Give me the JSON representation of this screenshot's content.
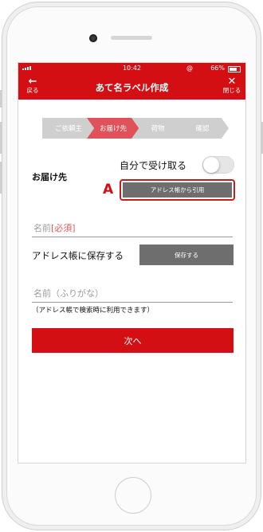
{
  "status_bar": {
    "time": "10:42",
    "battery": "66%"
  },
  "nav": {
    "back_label": "戻る",
    "title": "あて名ラベル作成",
    "close_label": "閉じる"
  },
  "steps": [
    {
      "label": "ご依頼主",
      "active": false
    },
    {
      "label": "お届け先",
      "active": true
    },
    {
      "label": "荷物",
      "active": false
    },
    {
      "label": "確認",
      "active": false
    }
  ],
  "destination": {
    "section_label": "お届け先",
    "self_receive_label": "自分で受け取る",
    "self_receive_on": false,
    "annotation_marker": "A",
    "address_book_button": "アドレス帳から引用"
  },
  "name_field": {
    "placeholder": "名前",
    "required_tag": "[必須]"
  },
  "save_address": {
    "label": "アドレス帳に保存する",
    "button": "保存する"
  },
  "kana_field": {
    "placeholder": "名前（ふりがな）"
  },
  "kana_note": "（アドレス帳で検索時に利用できます）",
  "next_button": "次へ",
  "colors": {
    "brand_red": "#d40f14",
    "active_step": "#e0525a",
    "inactive_step": "#cfcfcf",
    "button_gray": "#6e6e6e"
  }
}
